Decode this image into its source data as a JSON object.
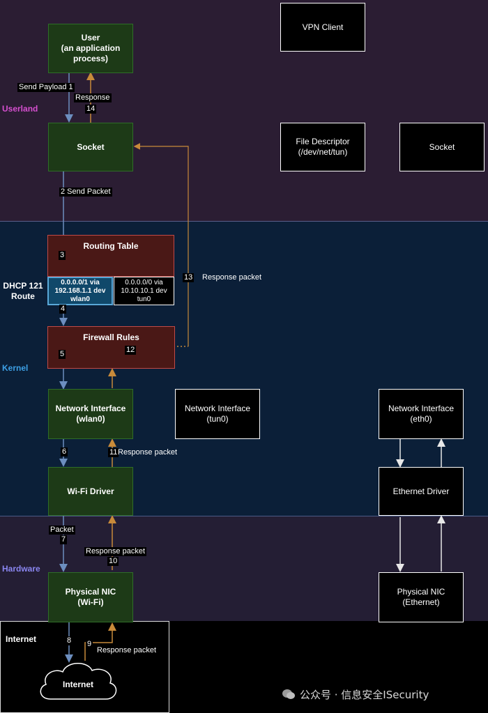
{
  "sections": {
    "userland": "Userland",
    "kernel": "Kernel",
    "hardware": "Hardware",
    "internet": "Internet"
  },
  "colors": {
    "userland_bg": "#2b1d33",
    "kernel_bg": "#0b1f38",
    "hardware_bg": "#241e34",
    "userland_label": "#d64fd0",
    "kernel_label": "#3da0e6",
    "hardware_label": "#8a86f0",
    "request_arrow": "#6c8ebf",
    "response_arrow": "#c88a3a"
  },
  "boxes": {
    "user": "User\n(an application\nprocess)",
    "vpn_client": "VPN Client",
    "socket_left": "Socket",
    "file_descriptor": "File Descriptor\n(/dev/net/tun)",
    "socket_right": "Socket",
    "routing_table": "Routing Table",
    "route_wlan0": "0.0.0.0/1 via\n192.168.1.1 dev\nwlan0",
    "route_tun0": "0.0.0.0/0 via\n10.10.10.1 dev\ntun0",
    "firewall_rules": "Firewall Rules",
    "netif_wlan0": "Network Interface\n(wlan0)",
    "netif_tun0": "Network Interface\n(tun0)",
    "netif_eth0": "Network Interface\n(eth0)",
    "wifi_driver": "Wi-Fi Driver",
    "ethernet_driver": "Ethernet Driver",
    "nic_wifi": "Physical NIC\n(Wi-Fi)",
    "nic_ethernet": "Physical NIC\n(Ethernet)",
    "internet_cloud": "Internet"
  },
  "dhcp_label": "DHCP 121\nRoute",
  "steps": {
    "s1": "Send Payload  1",
    "s2": "2  Send Packet",
    "s3": "3",
    "s4": "4",
    "s5": "5",
    "s6": "6",
    "s7_label": "Packet",
    "s7": "7",
    "s8": "8",
    "s9": "9",
    "s9_label": "Response packet",
    "s10_label": "Response packet",
    "s10": "10",
    "s11": "11",
    "s11_label": "Response packet",
    "s12": "12",
    "s13": "13",
    "s13_label": "Response packet",
    "s14_label": "Response",
    "s14": "14"
  },
  "watermark": "公众号 · 信息安全ISecurity"
}
